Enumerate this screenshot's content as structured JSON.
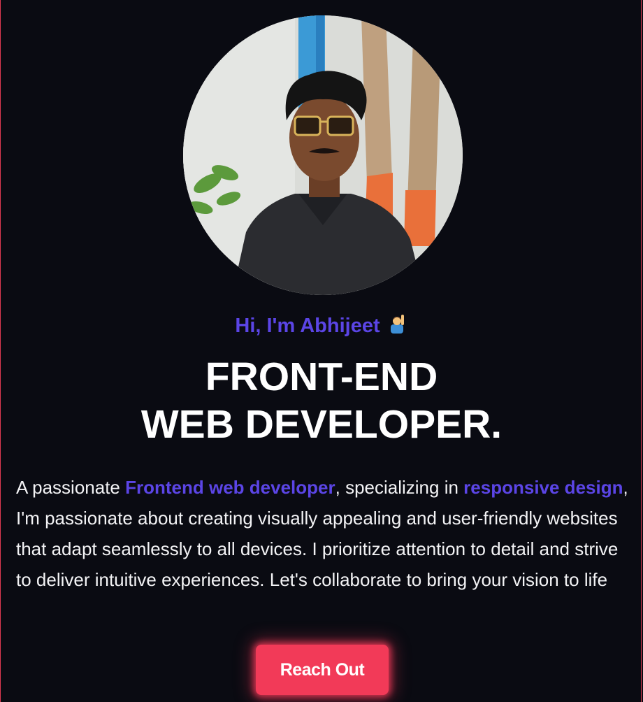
{
  "profile": {
    "photo_alt": "Portrait of Abhijeet",
    "greeting": "Hi, I'm Abhijeet",
    "greeting_emoji": "person-raising-hand-icon",
    "headline_line1": "FRONT-END",
    "headline_line2": "WEB DEVELOPER."
  },
  "intro": {
    "part1": "A passionate ",
    "highlight1": "Frontend web developer",
    "part2": ", specializing in ",
    "highlight2": "responsive design",
    "part3": ", I'm passionate about creating visually appealing and user-friendly websites that adapt seamlessly to all devices. I prioritize attention to detail and strive to deliver intuitive experiences. Let's collaborate to bring your vision to life"
  },
  "cta": {
    "label": "Reach Out"
  },
  "colors": {
    "background": "#0a0b12",
    "accent": "#5b45e6",
    "button": "#f23a58",
    "text": "#ffffff",
    "border": "#e13a52"
  }
}
